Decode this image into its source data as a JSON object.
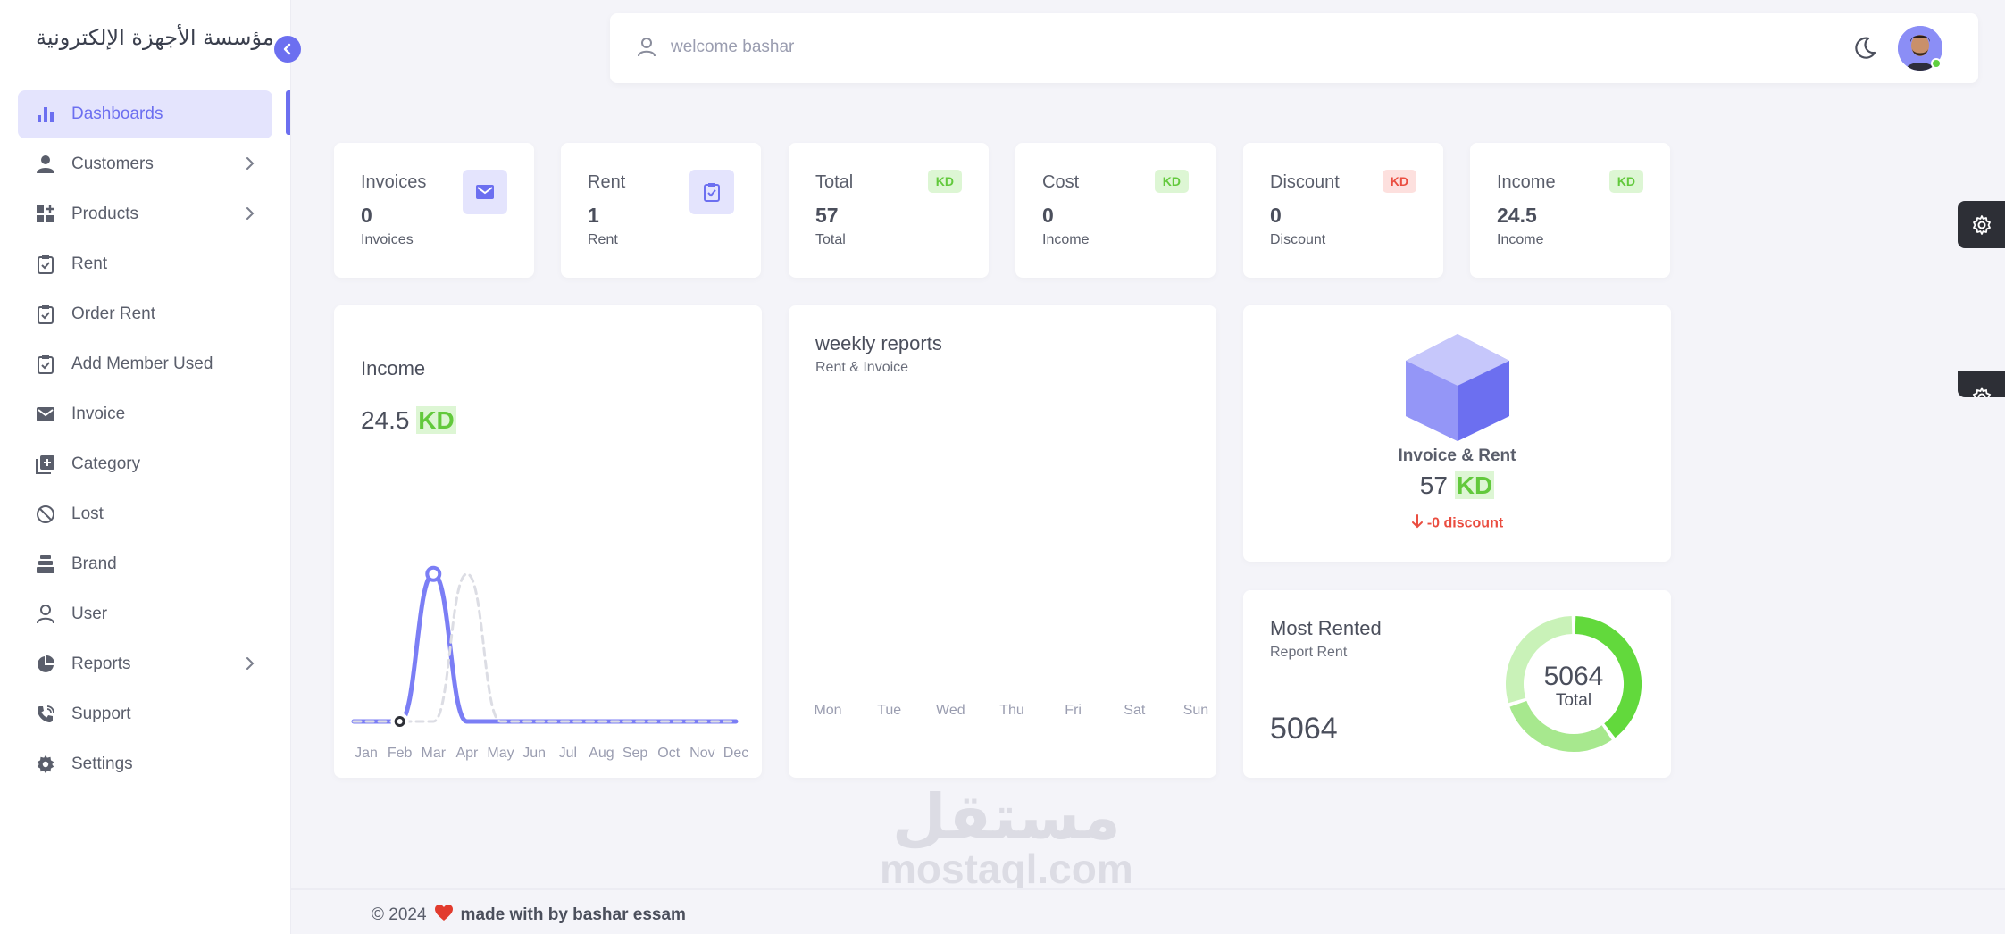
{
  "brand": {
    "name": "مؤسسة الأجهزة الإلكترونية"
  },
  "sidebar": {
    "items": [
      {
        "label": "Dashboards",
        "icon": "bar-chart-icon",
        "active": true,
        "chevron": false
      },
      {
        "label": "Customers",
        "icon": "person-icon",
        "chevron": true
      },
      {
        "label": "Products",
        "icon": "grid-plus-icon",
        "chevron": true
      },
      {
        "label": "Rent",
        "icon": "clipboard-check-icon",
        "chevron": false
      },
      {
        "label": "Order Rent",
        "icon": "clipboard-check-icon",
        "chevron": false
      },
      {
        "label": "Add Member Used",
        "icon": "clipboard-check-icon",
        "chevron": false
      },
      {
        "label": "Invoice",
        "icon": "envelope-icon",
        "chevron": false
      },
      {
        "label": "Category",
        "icon": "stack-plus-icon",
        "chevron": false
      },
      {
        "label": "Lost",
        "icon": "ban-icon",
        "chevron": false
      },
      {
        "label": "Brand",
        "icon": "layers-icon",
        "chevron": false
      },
      {
        "label": "User",
        "icon": "user-outline-icon",
        "chevron": false
      },
      {
        "label": "Reports",
        "icon": "pie-chart-icon",
        "chevron": true
      },
      {
        "label": "Support",
        "icon": "phone-icon",
        "chevron": false
      },
      {
        "label": "Settings",
        "icon": "gear-icon",
        "chevron": false
      }
    ]
  },
  "topbar": {
    "welcome": "welcome bashar"
  },
  "stats": [
    {
      "title": "Invoices",
      "value": "0",
      "sub": "Invoices",
      "icon": "envelope-icon"
    },
    {
      "title": "Rent",
      "value": "1",
      "sub": "Rent",
      "icon": "clipboard-check-icon"
    },
    {
      "title": "Total",
      "value": "57",
      "sub": "Total",
      "badge": "KD",
      "badge_color": "green"
    },
    {
      "title": "Cost",
      "value": "0",
      "sub": "Income",
      "badge": "KD",
      "badge_color": "green"
    },
    {
      "title": "Discount",
      "value": "0",
      "sub": "Discount",
      "badge": "KD",
      "badge_color": "red"
    },
    {
      "title": "Income",
      "value": "24.5",
      "sub": "Income",
      "badge": "KD",
      "badge_color": "green"
    }
  ],
  "income_card": {
    "title": "Income",
    "value": "24.5",
    "unit": "KD"
  },
  "weekly_card": {
    "title": "weekly reports",
    "subtitle": "Rent & Invoice"
  },
  "invoice_rent_card": {
    "title": "Invoice & Rent",
    "value": "57",
    "unit": "KD",
    "discount": "-0 discount"
  },
  "most_rented_card": {
    "title": "Most Rented",
    "subtitle": "Report Rent",
    "value": "5064",
    "donut_value": "5064",
    "donut_label": "Total"
  },
  "footer": {
    "copyright": "© 2024",
    "text": "made with by bashar essam"
  },
  "watermark": {
    "arabic": "مستقل",
    "latin": "mostaql.com"
  },
  "colors": {
    "accent": "#6c6ff0",
    "green": "#62c93c",
    "red": "#ea4d40"
  },
  "chart_data": [
    {
      "type": "line",
      "title": "",
      "categories": [
        "Jan",
        "Feb",
        "Mar",
        "Apr",
        "May",
        "Jun",
        "Jul",
        "Aug",
        "Sep",
        "Oct",
        "Nov",
        "Dec"
      ],
      "series": [
        {
          "values": [
            0,
            0,
            24.5,
            0,
            0,
            0,
            0,
            0,
            0,
            0,
            0,
            0
          ],
          "color": "#7b7ef5"
        },
        {
          "values": [
            0,
            0,
            0,
            24.5,
            0,
            0,
            0,
            0,
            0,
            0,
            0,
            0
          ],
          "color": "#dcdde4",
          "dashed": true
        }
      ],
      "ylim": [
        0,
        30
      ],
      "grid": false
    },
    {
      "type": "bar",
      "title": "",
      "categories": [
        "Mon",
        "Tue",
        "Wed",
        "Thu",
        "Fri",
        "Sat",
        "Sun"
      ],
      "values": [
        0,
        0,
        0,
        0,
        0,
        0,
        0
      ]
    },
    {
      "type": "pie",
      "title": "",
      "values": [
        40,
        30,
        30
      ],
      "colors": [
        "#62d93c",
        "#a7e88e",
        "#c9f2b8"
      ]
    }
  ]
}
